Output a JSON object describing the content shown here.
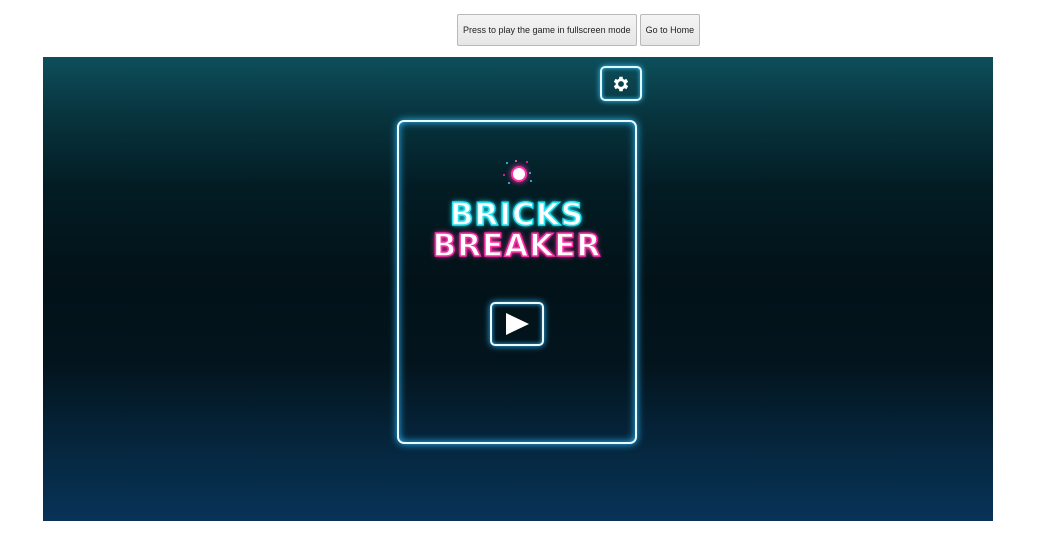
{
  "toolbar": {
    "fullscreen_label": "Press to play the game in fullscreen mode",
    "home_label": "Go to Home"
  },
  "game": {
    "title_line1": "BRICKS",
    "title_line2": "BREAKER",
    "settings_icon": "gear-icon",
    "play_icon": "play-icon",
    "colors": {
      "frame_glow": "#2fb9ff",
      "title_cyan": "#27e1ee",
      "title_pink": "#ff2fa8",
      "ball_outline": "#ff2fa8"
    }
  }
}
